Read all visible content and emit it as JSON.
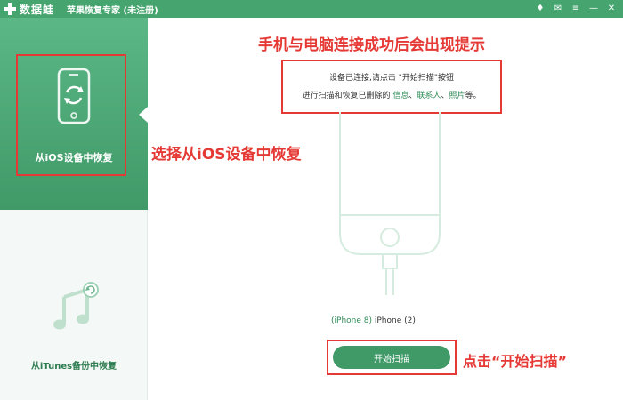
{
  "window": {
    "logo_text": "数据蛙",
    "title": "苹果恢复专家 (未注册)",
    "controls": [
      "♦",
      "✉",
      "≡",
      "—",
      "✕"
    ]
  },
  "sidebar": {
    "items": [
      {
        "label": "从iOS设备中恢复",
        "active": true,
        "icon": "phone-refresh-icon"
      },
      {
        "label": "从iTunes备份中恢复",
        "active": false,
        "icon": "music-note-icon"
      }
    ]
  },
  "main": {
    "prompt_line1": "设备已连接,请点击 \"开始扫描\"按钮",
    "prompt_line2_prefix": "进行扫描和恢复已删除的",
    "prompt_links": [
      "信息",
      "联系人",
      "照片"
    ],
    "prompt_sep": "、",
    "prompt_line2_suffix": "等。",
    "device_model": "(iPhone 8)",
    "device_name": "iPhone (2)",
    "scan_button": "开始扫描"
  },
  "annotations": {
    "top": "手机与电脑连接成功后会出现提示",
    "ios": "选择从iOS设备中恢复",
    "scan": "点击“开始扫描”"
  },
  "colors": {
    "accent": "#46a56f",
    "annotation": "#e53935"
  }
}
